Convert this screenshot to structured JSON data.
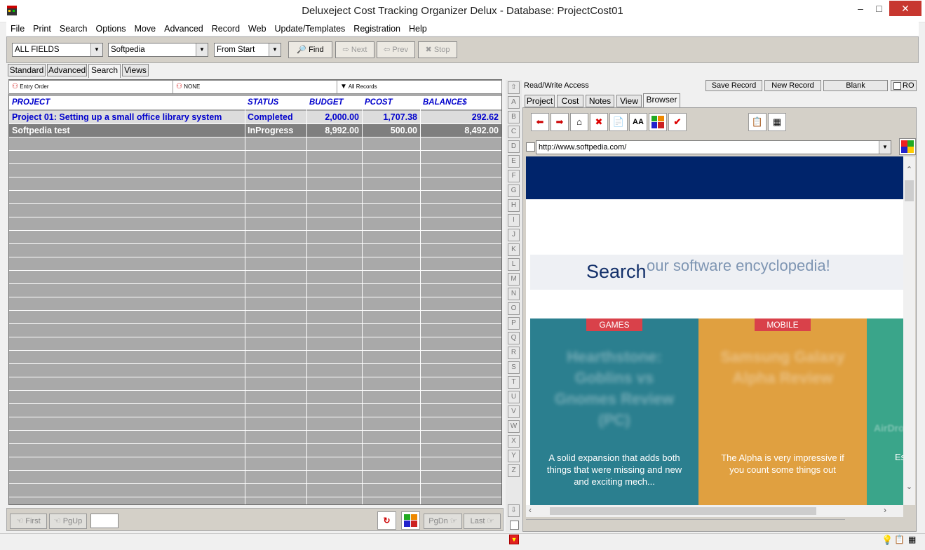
{
  "window": {
    "title": "Deluxeject Cost Tracking Organizer Delux - Database: ProjectCost01",
    "minimize": "–",
    "maximize": "□",
    "close": "✕"
  },
  "menu": [
    "File",
    "Print",
    "Search",
    "Options",
    "Move",
    "Advanced",
    "Record",
    "Web",
    "Update/Templates",
    "Registration",
    "Help"
  ],
  "toolbar": {
    "field_combo": "ALL FIELDS",
    "search_value": "Softpedia",
    "scope_combo": "From Start",
    "find_label": "Find",
    "next_label": "Next",
    "prev_label": "Prev",
    "stop_label": "Stop"
  },
  "mode_tabs": [
    "Standard",
    "Advanced",
    "Search",
    "Views"
  ],
  "active_mode_tab": "Search",
  "sortbar": {
    "order": "Entry Order",
    "filter": "NONE",
    "records": "All Records"
  },
  "grid": {
    "columns": [
      "PROJECT",
      "STATUS",
      "BUDGET",
      "PCOST",
      "BALANCE$"
    ],
    "rows": [
      {
        "project": "Project 01: Setting up a small office library system",
        "status": "Completed",
        "budget": "2,000.00",
        "pcost": "1,707.38",
        "balance": "292.62"
      },
      {
        "project": "Softpedia test",
        "status": "InProgress",
        "budget": "8,992.00",
        "pcost": "500.00",
        "balance": "8,492.00"
      }
    ]
  },
  "bottom_nav": {
    "first": "First",
    "pgup": "PgUp",
    "pgdn": "PgDn",
    "last": "Last"
  },
  "alpha_index": [
    "A",
    "B",
    "C",
    "D",
    "E",
    "F",
    "G",
    "H",
    "I",
    "J",
    "K",
    "L",
    "M",
    "N",
    "O",
    "P",
    "Q",
    "R",
    "S",
    "T",
    "U",
    "V",
    "W",
    "X",
    "Y",
    "Z"
  ],
  "right": {
    "access": "Read/Write Access",
    "save_record": "Save Record",
    "new_record": "New Record",
    "blank": "Blank",
    "ro": "RO",
    "tabs": [
      "Project",
      "Cost",
      "Notes",
      "View",
      "Browser"
    ],
    "active_tab": "Browser",
    "url": "http://www.softpedia.com/"
  },
  "webpage": {
    "search_word": "Search",
    "search_tagline": "our software encyclopedia!",
    "cards": [
      {
        "badge": "GAMES",
        "blur_title": "Hearthstone: Goblins vs Gnomes Review (PC)",
        "caption": "A solid expansion that adds both things that were missing and new and exciting mech...",
        "color": "#2b7f8f"
      },
      {
        "badge": "MOBILE",
        "blur_title": "Samsung Galaxy Alpha Review",
        "caption": "The Alpha is very impressive if you count some things out",
        "color": "#e0a040"
      },
      {
        "badge": "",
        "blur_title": "AirDroid",
        "caption": "Es",
        "color": "#3aa58a"
      }
    ]
  }
}
